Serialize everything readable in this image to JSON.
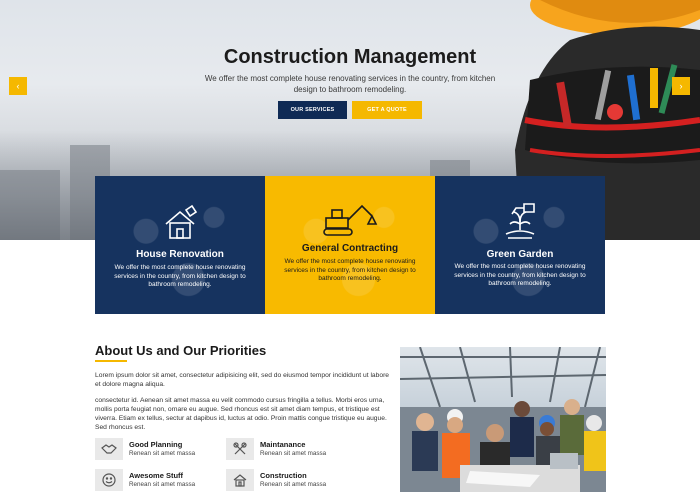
{
  "hero": {
    "title": "Construction Management",
    "subtitle": "We offer the most complete house renovating services in the country, from kitchen design to bathroom remodeling.",
    "btn_services": "OUR SERVICES",
    "btn_quote": "GET A QUOTE",
    "prev_arrow": "‹",
    "next_arrow": "›"
  },
  "features": [
    {
      "title": "House Renovation",
      "text": "We offer the most complete house renovating services in the country, from kitchen design to bathroom remodeling.",
      "icon": "house-icon",
      "color": "#16335f"
    },
    {
      "title": "General Contracting",
      "text": "We offer the most complete house renovating services in the country, from kitchen design to bathroom remodeling.",
      "icon": "excavator-icon",
      "color": "#f8ba00"
    },
    {
      "title": "Green Garden",
      "text": "We offer the most complete house renovating services in the country, from kitchen design to bathroom remodeling.",
      "icon": "garden-icon",
      "color": "#16335f"
    }
  ],
  "about": {
    "title": "About Us and Our Priorities",
    "p1": "Lorem ipsum dolor sit amet, consectetur adipisicing elit, sed do eiusmod tempor incididunt ut labore et dolore magna aliqua.",
    "p2": "consectetur id. Aenean sit amet massa eu velit commodo cursus fringilla a tellus. Morbi eros urna, mollis porta feugiat non, ornare eu augue. Sed rhoncus est sit amet diam tempus, et tristique est viverra. Etiam ex tellus, sectur at dapibus id, luctus at odio. Proin mattis congue tristique eu augue. Sed rhoncus est.",
    "priorities": [
      {
        "title": "Good Planning",
        "sub": "Renean sit amet massa",
        "icon": "handshake-icon"
      },
      {
        "title": "Maintanance",
        "sub": "Renean sit amet massa",
        "icon": "tools-icon"
      },
      {
        "title": "Awesome Stuff",
        "sub": "Renean sit amet massa",
        "icon": "smiley-icon"
      },
      {
        "title": "Construction",
        "sub": "Renean sit amet massa",
        "icon": "house-build-icon"
      }
    ]
  },
  "colors": {
    "navy": "#16335f",
    "yellow": "#f5b800",
    "button_navy": "#0f2a55"
  }
}
